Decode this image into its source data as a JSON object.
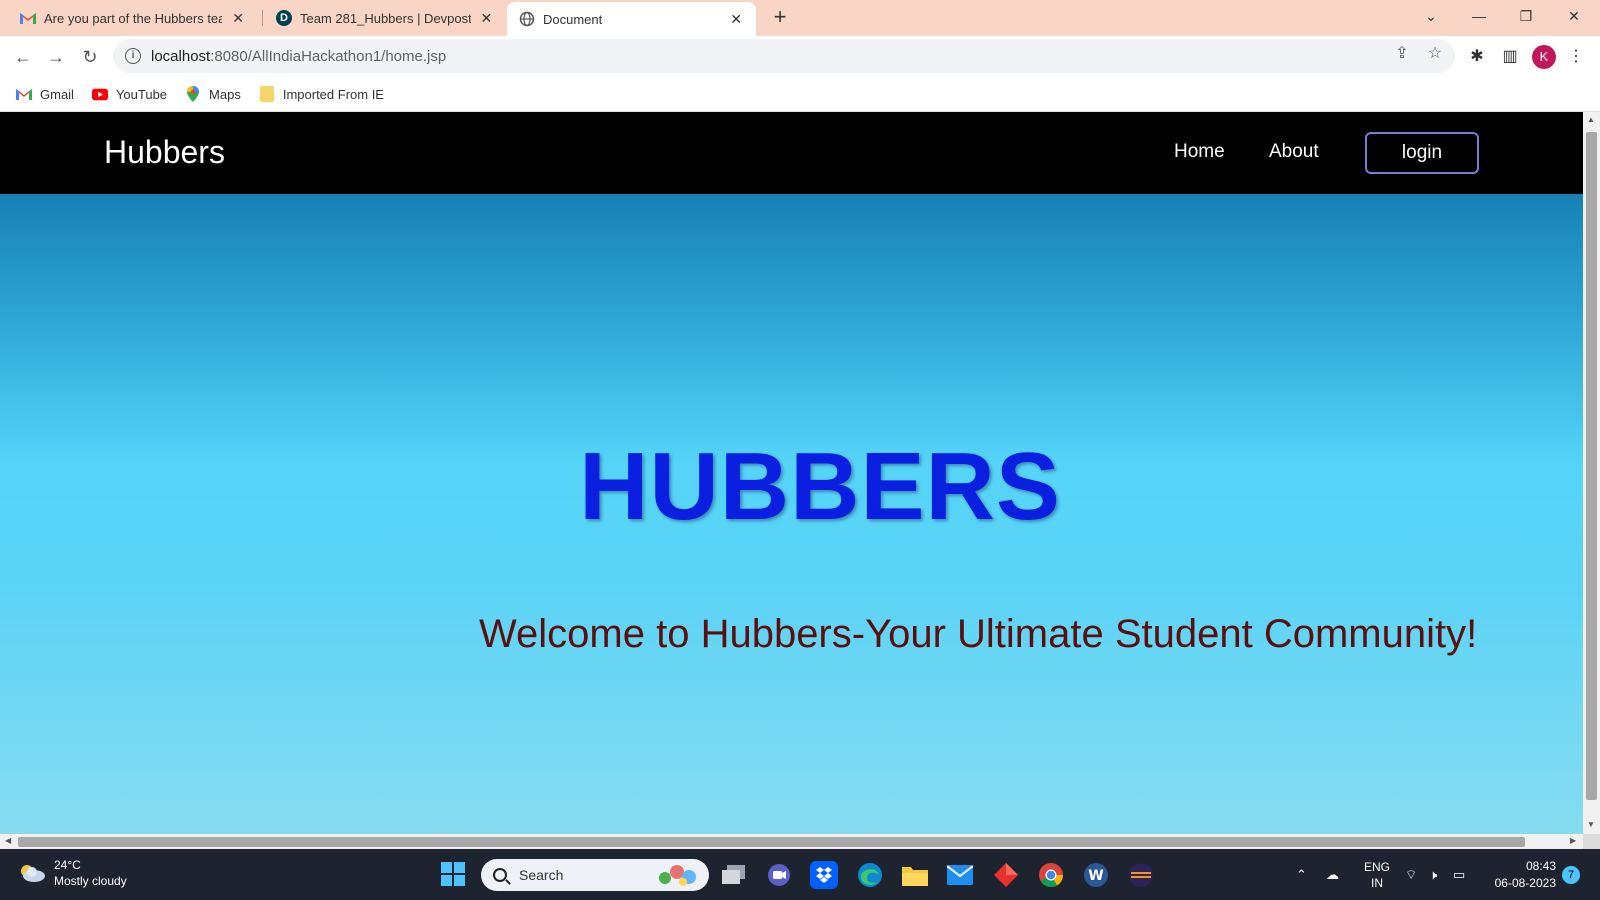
{
  "browser": {
    "tabs": [
      {
        "title": "Are you part of the Hubbers team",
        "icon": "gmail-icon",
        "active": false
      },
      {
        "title": "Team 281_Hubbers | Devpost",
        "icon": "devpost-icon",
        "active": false
      },
      {
        "title": "Document",
        "icon": "globe-icon",
        "active": true
      }
    ],
    "url_host": "localhost",
    "url_rest": ":8080/AllIndiaHackathon1/home.jsp",
    "profile_initial": "K",
    "bookmarks": [
      {
        "label": "Gmail",
        "icon": "gmail-icon"
      },
      {
        "label": "YouTube",
        "icon": "youtube-icon"
      },
      {
        "label": "Maps",
        "icon": "maps-icon"
      },
      {
        "label": "Imported From IE",
        "icon": "folder-icon"
      }
    ]
  },
  "site": {
    "brand": "Hubbers",
    "nav": {
      "home": "Home",
      "about": "About",
      "login": "login"
    },
    "hero_title": "HUBBERS",
    "hero_subtitle": "Welcome to Hubbers-Your Ultimate Student Community!"
  },
  "taskbar": {
    "weather_temp": "24°C",
    "weather_desc": "Mostly cloudy",
    "search_placeholder": "Search",
    "lang_1": "ENG",
    "lang_2": "IN",
    "time": "08:43",
    "date": "06-08-2023",
    "notification_count": "7"
  },
  "colors": {
    "nav_bg": "#000000",
    "hero_title": "#0a1fe0",
    "hero_subtitle": "#5a1010",
    "tab_strip": "#f9d5c6"
  }
}
